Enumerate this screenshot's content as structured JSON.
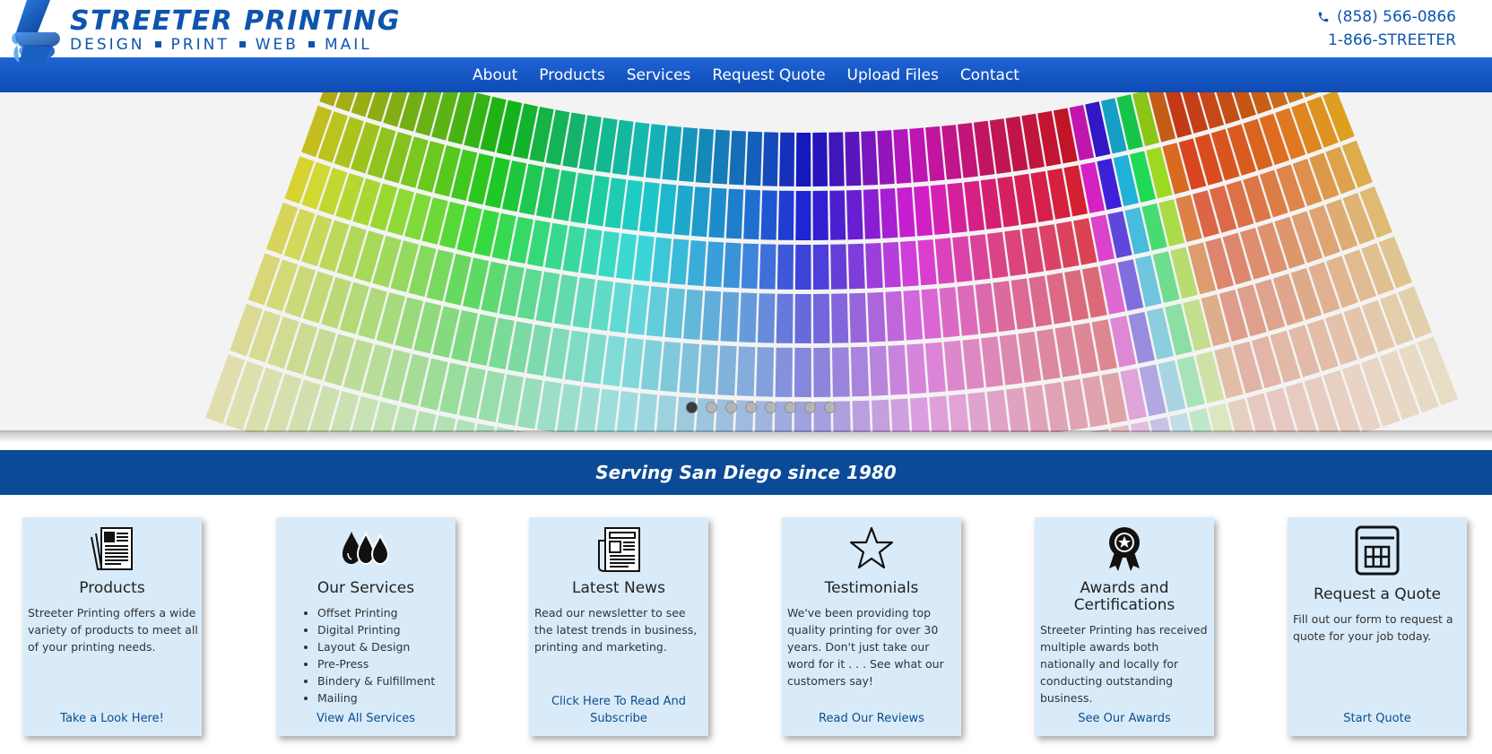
{
  "header": {
    "logo_title": "STREETER PRINTING",
    "logo_tagline": [
      "DESIGN",
      "PRINT",
      "WEB",
      "MAIL"
    ],
    "phone_main": "(858) 566-0866",
    "phone_alt": "1-866-STREETER"
  },
  "nav": {
    "items": [
      {
        "label": "About"
      },
      {
        "label": "Products"
      },
      {
        "label": "Services"
      },
      {
        "label": "Request Quote"
      },
      {
        "label": "Upload Files"
      },
      {
        "label": "Contact"
      }
    ]
  },
  "slider": {
    "slide_count": 8,
    "active_index": 0
  },
  "banner": {
    "text": "Serving San Diego since 1980"
  },
  "cards": [
    {
      "icon": "newspapers-icon",
      "title": "Products",
      "body": "Streeter Printing offers a wide variety of products to meet all of your printing needs.",
      "link": "Take a Look Here!"
    },
    {
      "icon": "ink-drops-icon",
      "title": "Our Services",
      "list": [
        "Offset Printing",
        "Digital Printing",
        "Layout & Design",
        "Pre-Press",
        "Bindery & Fulfillment",
        "Mailing"
      ],
      "link": "View All Services"
    },
    {
      "icon": "newspaper-icon",
      "title": "Latest News",
      "body": "Read our newsletter to see the latest trends in business, printing and marketing.",
      "link": "Click Here To Read And Subscribe"
    },
    {
      "icon": "star-icon",
      "title": "Testimonials",
      "body": "We've been providing top quality printing for over 30 years. Don't just take our word for it . . . See what our customers say!",
      "link": "Read Our Reviews"
    },
    {
      "icon": "award-ribbon-icon",
      "title": "Awards and Certifications",
      "body": "Streeter Printing has received multiple awards both nationally and locally for conducting outstanding business.",
      "link": "See Our Awards"
    },
    {
      "icon": "calculator-icon",
      "title": "Request a Quote",
      "body": "Fill out our form to request a quote for your job today.",
      "link": "Start Quote"
    }
  ],
  "colors": {
    "brand_blue": "#0d55ad",
    "nav_blue": "#1a5cc8",
    "banner_blue": "#0b4a96",
    "card_bg": "#d9ebf9",
    "link": "#0c4e8e"
  }
}
